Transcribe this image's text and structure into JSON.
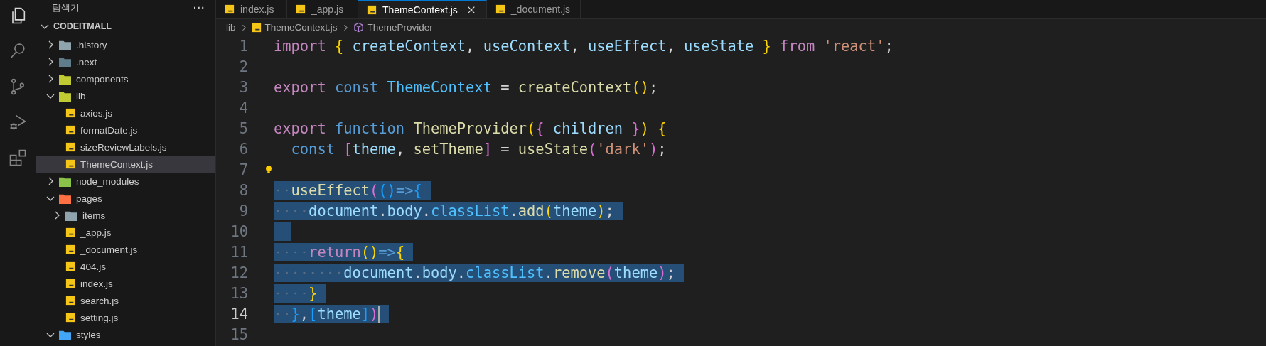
{
  "activity_bar": [
    {
      "kind": "files",
      "selected": true
    },
    {
      "kind": "search",
      "selected": false
    },
    {
      "kind": "source-control",
      "selected": false
    },
    {
      "kind": "run-debug",
      "selected": false
    },
    {
      "kind": "extensions",
      "selected": false
    }
  ],
  "sidebar": {
    "title": "탐색기",
    "more": "···",
    "project": {
      "name": "CODEITMALL",
      "expanded": true
    },
    "tree": [
      {
        "name": ".history",
        "kind": "folder",
        "color": "#90a4ae",
        "expanded": false,
        "selected": false
      },
      {
        "name": ".next",
        "kind": "folder",
        "color": "#607d8b",
        "expanded": false,
        "selected": false
      },
      {
        "name": "components",
        "kind": "folder",
        "color": "#c0ca33",
        "expanded": false,
        "selected": false
      },
      {
        "name": "lib",
        "kind": "folder",
        "color": "#c0ca33",
        "expanded": true,
        "selected": false,
        "children": [
          {
            "name": "axios.js",
            "kind": "file",
            "selected": false
          },
          {
            "name": "formatDate.js",
            "kind": "file",
            "selected": false
          },
          {
            "name": "sizeReviewLabels.js",
            "kind": "file",
            "selected": false
          },
          {
            "name": "ThemeContext.js",
            "kind": "file",
            "selected": true
          }
        ]
      },
      {
        "name": "node_modules",
        "kind": "folder",
        "color": "#8bc34a",
        "expanded": false,
        "selected": false
      },
      {
        "name": "pages",
        "kind": "folder",
        "color": "#ff7043",
        "expanded": true,
        "selected": false,
        "children": [
          {
            "name": "items",
            "kind": "folder",
            "color": "#90a4ae",
            "expanded": false,
            "selected": false
          },
          {
            "name": "_app.js",
            "kind": "file",
            "selected": false
          },
          {
            "name": "_document.js",
            "kind": "file",
            "selected": false
          },
          {
            "name": "404.js",
            "kind": "file",
            "selected": false
          },
          {
            "name": "index.js",
            "kind": "file",
            "selected": false
          },
          {
            "name": "search.js",
            "kind": "file",
            "selected": false
          },
          {
            "name": "setting.js",
            "kind": "file",
            "selected": false
          }
        ]
      },
      {
        "name": "styles",
        "kind": "folder",
        "color": "#42a5f5",
        "expanded": true,
        "selected": false
      }
    ]
  },
  "tabs": [
    {
      "label": "index.js",
      "selected": false
    },
    {
      "label": "_app.js",
      "selected": false
    },
    {
      "label": "ThemeContext.js",
      "selected": true
    },
    {
      "label": "_document.js",
      "selected": false
    }
  ],
  "breadcrumb": [
    {
      "label": "lib",
      "kind": "folder"
    },
    {
      "label": "ThemeContext.js",
      "kind": "file"
    },
    {
      "label": "ThemeProvider",
      "kind": "symbol"
    }
  ],
  "editor": {
    "lines": [
      {
        "number": "1",
        "selected": false,
        "current": false,
        "tokens": [
          {
            "kind": "ctrl",
            "s": "import "
          },
          {
            "kind": "b1",
            "s": "{ "
          },
          {
            "kind": "var",
            "s": "createContext"
          },
          {
            "kind": "p",
            "s": ", "
          },
          {
            "kind": "var",
            "s": "useContext"
          },
          {
            "kind": "p",
            "s": ", "
          },
          {
            "kind": "var",
            "s": "useEffect"
          },
          {
            "kind": "p",
            "s": ", "
          },
          {
            "kind": "var",
            "s": "useState "
          },
          {
            "kind": "b1",
            "s": "} "
          },
          {
            "kind": "ctrl",
            "s": "from "
          },
          {
            "kind": "str",
            "s": "'react'"
          },
          {
            "kind": "p",
            "s": ";"
          }
        ]
      },
      {
        "number": "2",
        "selected": false,
        "current": false
      },
      {
        "number": "3",
        "selected": false,
        "current": false,
        "tokens": [
          {
            "kind": "ctrl",
            "s": "export "
          },
          {
            "kind": "kw",
            "s": "const "
          },
          {
            "kind": "const",
            "s": "ThemeContext"
          },
          {
            "kind": "p",
            "s": " = "
          },
          {
            "kind": "fn",
            "s": "createContext"
          },
          {
            "kind": "b1",
            "s": "()"
          },
          {
            "kind": "p",
            "s": ";"
          }
        ]
      },
      {
        "number": "4",
        "selected": false,
        "current": false
      },
      {
        "number": "5",
        "selected": false,
        "current": false,
        "tokens": [
          {
            "kind": "ctrl",
            "s": "export "
          },
          {
            "kind": "kw",
            "s": "function "
          },
          {
            "kind": "fn",
            "s": "ThemeProvider"
          },
          {
            "kind": "b1",
            "s": "("
          },
          {
            "kind": "b2",
            "s": "{"
          },
          {
            "kind": "var",
            "s": " children "
          },
          {
            "kind": "b2",
            "s": "}"
          },
          {
            "kind": "b1",
            "s": ") {"
          }
        ]
      },
      {
        "number": "6",
        "selected": false,
        "current": false,
        "tokens": [
          {
            "kind": "kw",
            "s": "  const "
          },
          {
            "kind": "b2",
            "s": "["
          },
          {
            "kind": "var",
            "s": "theme"
          },
          {
            "kind": "p",
            "s": ", "
          },
          {
            "kind": "fn",
            "s": "setTheme"
          },
          {
            "kind": "b2",
            "s": "]"
          },
          {
            "kind": "p",
            "s": " = "
          },
          {
            "kind": "fn",
            "s": "useState"
          },
          {
            "kind": "b2",
            "s": "("
          },
          {
            "kind": "str",
            "s": "'dark'"
          },
          {
            "kind": "b2",
            "s": ")"
          },
          {
            "kind": "p",
            "s": ";"
          }
        ]
      },
      {
        "number": "7",
        "selected": false,
        "current": false,
        "lightbulb": true
      },
      {
        "number": "8",
        "selected": true,
        "current": false,
        "tokens": [
          {
            "kind": "fn",
            "s": "  useEffect"
          },
          {
            "kind": "b2",
            "s": "("
          },
          {
            "kind": "b3",
            "s": "()"
          },
          {
            "kind": "kw",
            "s": "=>"
          },
          {
            "kind": "b3",
            "s": "{"
          }
        ]
      },
      {
        "number": "9",
        "selected": true,
        "current": false,
        "tokens": [
          {
            "kind": "var",
            "s": "    document"
          },
          {
            "kind": "p",
            "s": "."
          },
          {
            "kind": "var",
            "s": "body"
          },
          {
            "kind": "p",
            "s": "."
          },
          {
            "kind": "const",
            "s": "classList"
          },
          {
            "kind": "p",
            "s": "."
          },
          {
            "kind": "fn",
            "s": "add"
          },
          {
            "kind": "b1",
            "s": "("
          },
          {
            "kind": "var",
            "s": "theme"
          },
          {
            "kind": "b1",
            "s": ")"
          },
          {
            "kind": "p",
            "s": ";"
          }
        ]
      },
      {
        "number": "10",
        "selected": true,
        "current": false
      },
      {
        "number": "11",
        "selected": true,
        "current": false,
        "tokens": [
          {
            "kind": "ctrl",
            "s": "    return"
          },
          {
            "kind": "b1",
            "s": "()"
          },
          {
            "kind": "kw",
            "s": "=>"
          },
          {
            "kind": "b1",
            "s": "{"
          }
        ]
      },
      {
        "number": "12",
        "selected": true,
        "current": false,
        "tokens": [
          {
            "kind": "var",
            "s": "        document"
          },
          {
            "kind": "p",
            "s": "."
          },
          {
            "kind": "var",
            "s": "body"
          },
          {
            "kind": "p",
            "s": "."
          },
          {
            "kind": "const",
            "s": "classList"
          },
          {
            "kind": "p",
            "s": "."
          },
          {
            "kind": "fn",
            "s": "remove"
          },
          {
            "kind": "b2",
            "s": "("
          },
          {
            "kind": "var",
            "s": "theme"
          },
          {
            "kind": "b2",
            "s": ")"
          },
          {
            "kind": "p",
            "s": ";"
          }
        ]
      },
      {
        "number": "13",
        "selected": true,
        "current": false,
        "tokens": [
          {
            "kind": "b1",
            "s": "    }"
          }
        ]
      },
      {
        "number": "14",
        "selected": true,
        "current": true,
        "tokens": [
          {
            "kind": "b3",
            "s": "  }"
          },
          {
            "kind": "p",
            "s": ","
          },
          {
            "kind": "b3",
            "s": "["
          },
          {
            "kind": "var",
            "s": "theme"
          },
          {
            "kind": "b3",
            "s": "]"
          },
          {
            "kind": "b2",
            "s": ")"
          }
        ]
      },
      {
        "number": "15",
        "selected": false,
        "current": false
      }
    ]
  }
}
